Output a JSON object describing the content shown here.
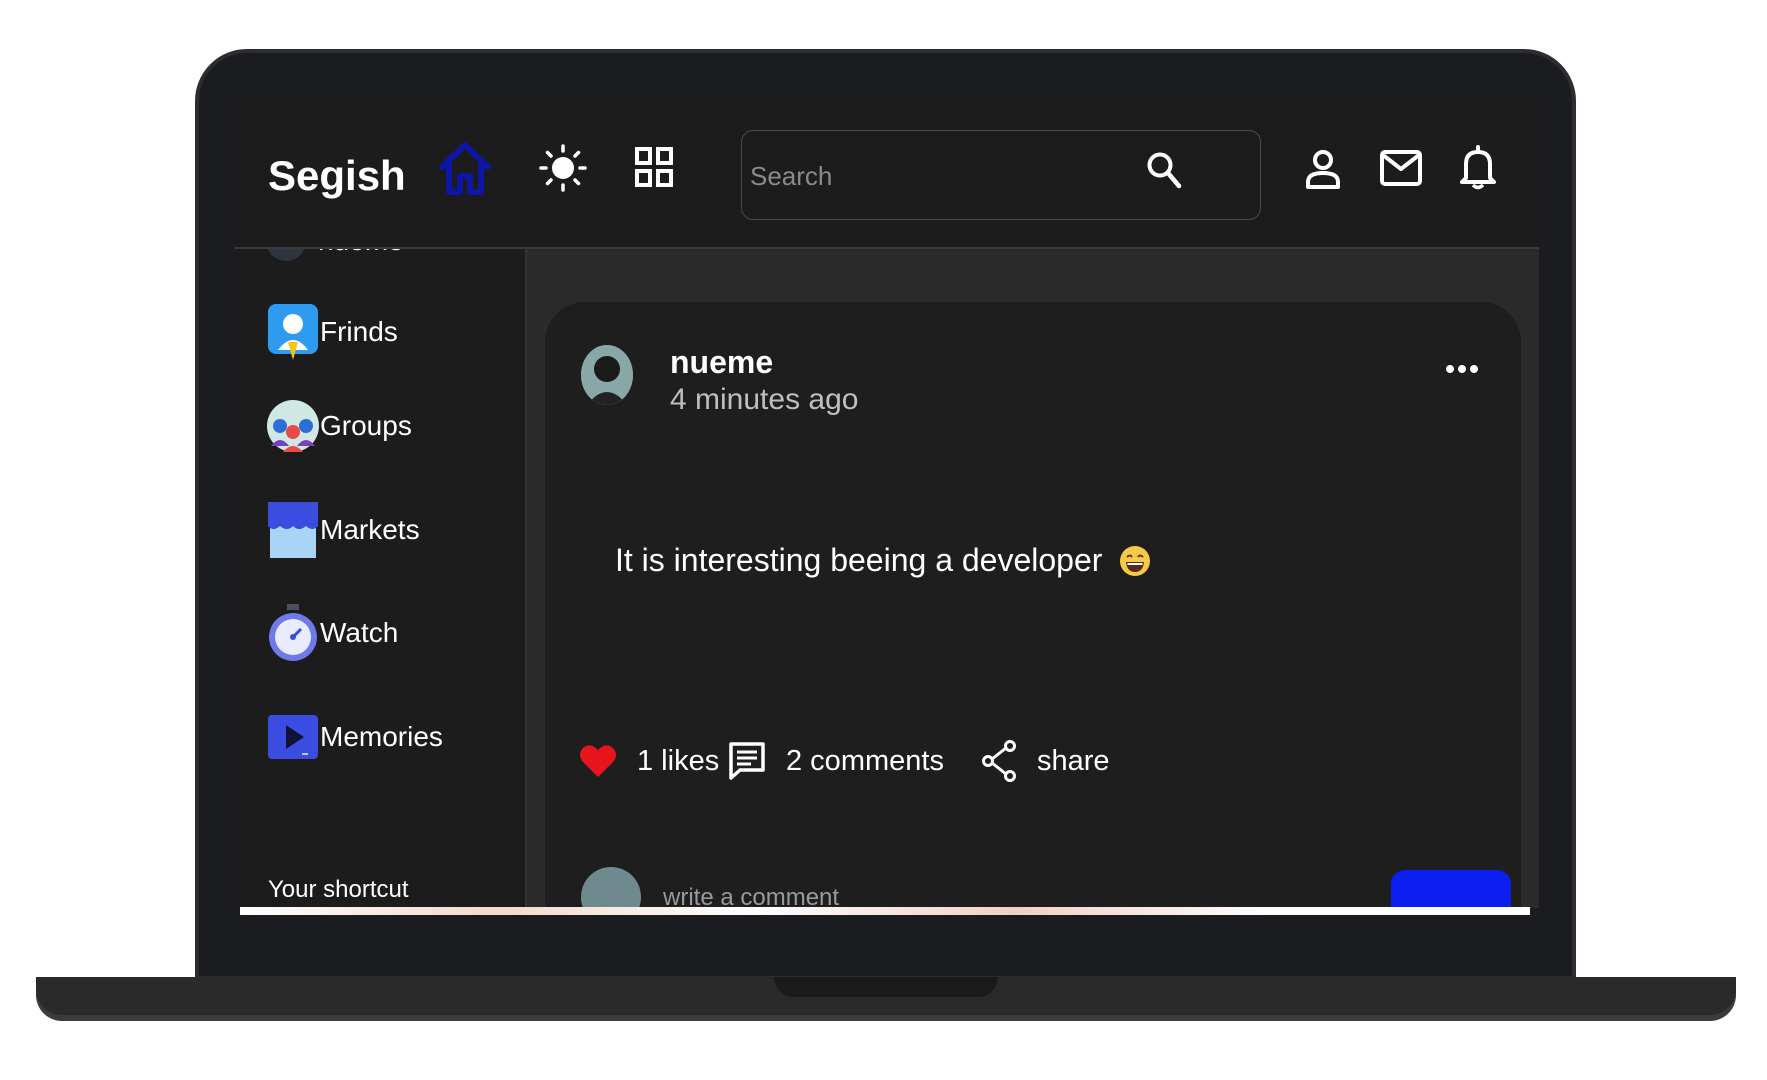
{
  "app": {
    "logo": "Segish"
  },
  "colors": {
    "accent_home": "#0e16a8",
    "like": "#e8141b",
    "send": "#0b1ff0"
  },
  "navbar": {
    "icons": [
      "home-icon",
      "sun-icon",
      "grid-icon",
      "search-icon",
      "user-icon",
      "mail-icon",
      "bell-icon"
    ],
    "search_placeholder": "Search"
  },
  "sidebar": {
    "partial_item_label": "nueme",
    "items": [
      {
        "label": "Frinds",
        "icon": "friends-icon"
      },
      {
        "label": "Groups",
        "icon": "groups-icon"
      },
      {
        "label": "Markets",
        "icon": "market-icon"
      },
      {
        "label": "Watch",
        "icon": "watch-icon"
      },
      {
        "label": "Memories",
        "icon": "memories-icon"
      }
    ],
    "shortcut_title": "Your shortcut"
  },
  "post": {
    "author": "nueme",
    "time": "4 minutes ago",
    "text": "It is interesting beeing a developer",
    "emoji": "grinning-emoji",
    "likes": "1 likes",
    "comments": "2 comments",
    "share": "share",
    "comment_placeholder": "write a comment"
  }
}
